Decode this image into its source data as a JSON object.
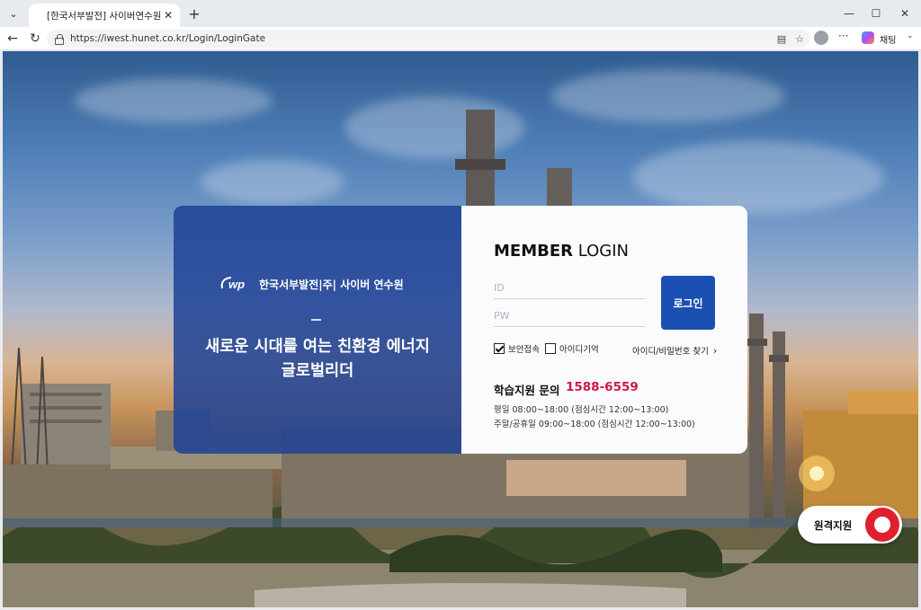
{
  "browser": {
    "tab_title": "[한국서부발전] 사이버연수원에 오",
    "url": "https://iwest.hunet.co.kr/Login/LoginGate",
    "copilot_label": "채팅"
  },
  "brand": {
    "logo_mark": "wp",
    "name": "한국서부발전|주| 사이버 연수원",
    "slogan_line1": "새로운 시대를 여는 친환경 에너지",
    "slogan_line2": "글로벌리더"
  },
  "login": {
    "title_bold": "MEMBER",
    "title_rest": " LOGIN",
    "id_placeholder": "ID",
    "pw_placeholder": "PW",
    "submit_label": "로그인",
    "secure_label": "보안접속",
    "secure_checked": true,
    "remember_label": "아이디기억",
    "remember_checked": false,
    "find_label": "아이디/비밀번호 찾기"
  },
  "support": {
    "title": "학습지원 문의",
    "phone": "1588-6559",
    "weekday_hours": "평일 08:00~18:00 (점심시간 12:00~13:00)",
    "weekend_hours": "주말/공휴일 09:00~18:00 (점심시간 12:00~13:00)"
  },
  "remote": {
    "label": "원격지원"
  },
  "colors": {
    "brand_blue": "#1b50b3",
    "accent_red": "#d0174a",
    "remote_red": "#e0202f"
  }
}
